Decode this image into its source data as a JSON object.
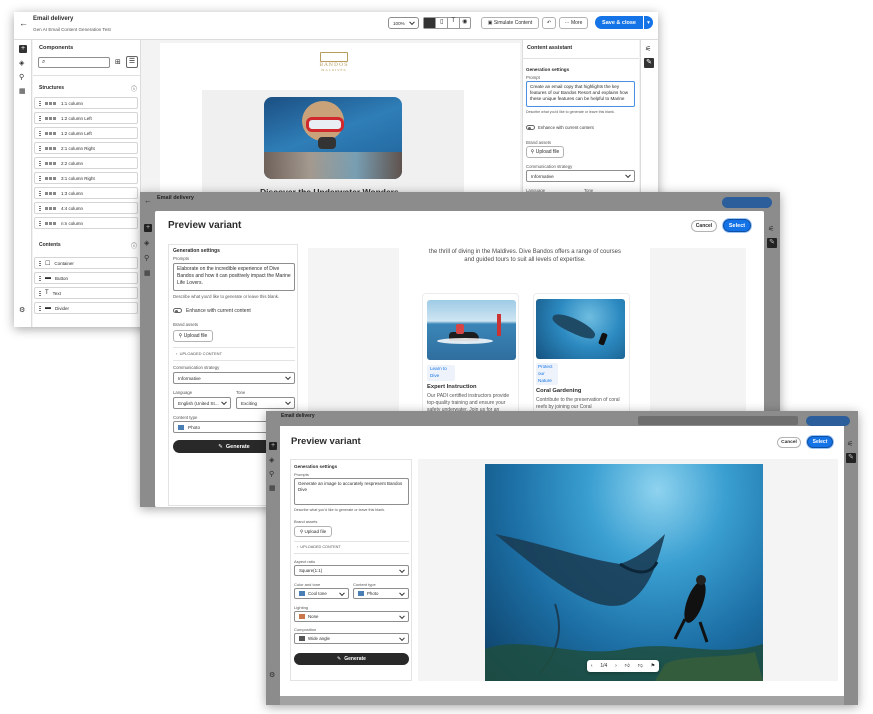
{
  "back": {
    "title": "Email delivery",
    "subtitle": "Gen AI Email Content Generation Test",
    "zoom": "100%",
    "simulate_label": "Simulate Content",
    "more_label": "More",
    "save_label": "Save & close",
    "components_title": "Components",
    "structures_title": "Structures",
    "structures": [
      "1:1 column",
      "1:2 column Left",
      "1:2 column Left",
      "2:1 column Right",
      "2:2 column",
      "3:1 column Right",
      "1:3 column",
      "4:4 column",
      "n:n column"
    ],
    "contents_title": "Contents",
    "contents": [
      "Container",
      "Button",
      "Text",
      "Divider"
    ],
    "logo_text": "BANDOS",
    "logo_sub": "MALDIVES",
    "email_heading": "Discover the Underwater Wonders",
    "assistant_title": "Content assistant",
    "gen_settings": "Generation settings",
    "prompt_label": "Prompt",
    "prompt_text": "Create an email copy that highlights the key features of our Bandos Resort and explains how these unique features can be helpful to Marine",
    "prompt_hint": "Describe what you'd like to generate or leave this blank.",
    "enhance_label": "Enhance with current content",
    "brand_assets": "Brand assets",
    "upload_label": "Upload file",
    "comm_label": "Communication strategy",
    "comm_value": "Informative",
    "lang_label": "Language",
    "tone_label": "Tone"
  },
  "middle": {
    "title": "Email delivery",
    "heading": "Preview variant",
    "cancel": "Cancel",
    "select": "Select",
    "gen_settings": "Generation settings",
    "prompt_label": "Prompts",
    "prompt_text": "Elaborate on the incredible experience of Dive Bandos and how it can positively impact the Marine Life Lovers.",
    "prompt_hint": "Describe what you'd like to generate or leave this blank.",
    "enhance_label": "Enhance with current content",
    "brand_assets": "Brand assets",
    "upload_label": "Upload file",
    "uploaded": "UPLOADED CONTENT",
    "comm_label": "Communication strategy",
    "comm_value": "Informative",
    "lang_label": "Language",
    "lang_value": "English (United St...",
    "tone_label": "Tone",
    "tone_value": "Exciting",
    "ctype_label": "Content type",
    "ctype_value": "Photo",
    "generate": "Generate",
    "preview_intro": "the thrill of diving in the Maldives. Dive Bandos offers a range of courses and guided tours to suit all levels of expertise.",
    "card1_link": "Learn to Dive",
    "card1_title": "Expert Instruction",
    "card1_text": "Our PADI certified instructors provide top-quality training and ensure your safety underwater. Join us for an",
    "card2_link": "Protect our Nature",
    "card2_title": "Coral Gardening",
    "card2_text": "Contribute to the preservation of coral reefs by joining our Coral"
  },
  "front": {
    "title": "Email delivery",
    "heading": "Preview variant",
    "cancel": "Cancel",
    "select": "Select",
    "gen_settings": "Generation settings",
    "prompt_label": "Prompts",
    "prompt_text": "Generate an image to accurately respresent Bandos Dive",
    "prompt_hint": "Describe what you'd like to generate or leave this blank.",
    "brand_assets": "Brand assets",
    "upload_label": "Upload file",
    "uploaded": "UPLOADED CONTENT",
    "aspect_label": "Aspect ratio",
    "aspect_value": "Square(1:1)",
    "color_label": "Color and tone",
    "color_value": "Cool tone",
    "ctype_label": "Content type",
    "ctype_value": "Photo",
    "lighting_label": "Lighting",
    "lighting_value": "None",
    "comp_label": "Composition",
    "comp_value": "Wide angle",
    "generate": "Generate",
    "pager": "1/4"
  }
}
